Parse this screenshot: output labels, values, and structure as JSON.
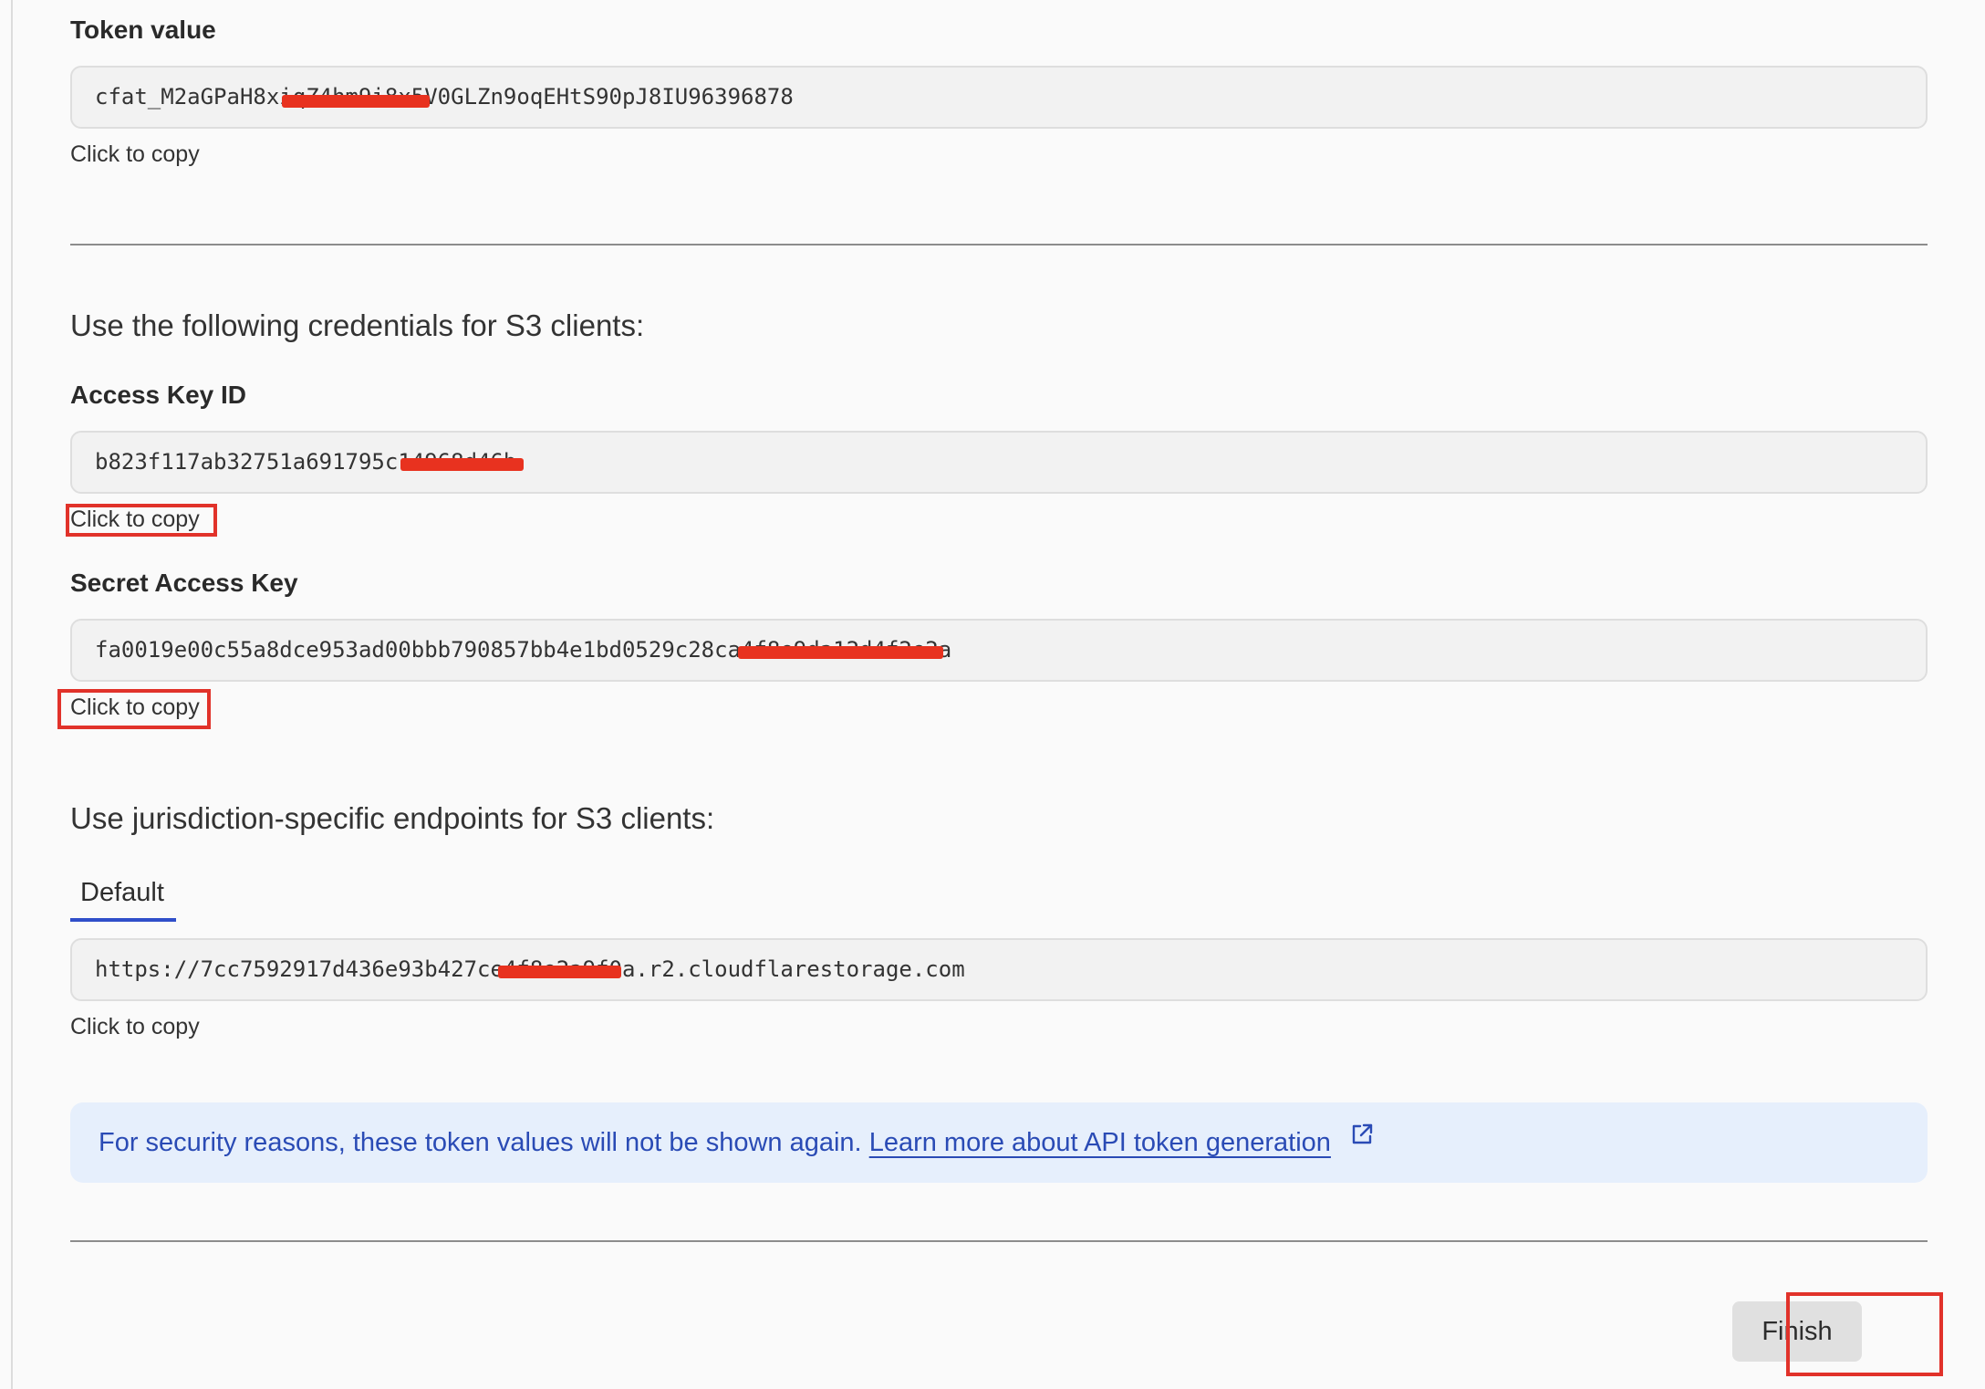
{
  "token": {
    "label": "Token value",
    "value": "cfat_M2aGPaH8xiqZ4hm9i8x5V0GLZn9oqEHtS90pJ8IU96396878",
    "copy_label": "Click to copy"
  },
  "s3": {
    "heading": "Use the following credentials for S3 clients:",
    "access_key": {
      "label": "Access Key ID",
      "value": "b823f117ab32751a691795c14968d46b",
      "copy_label": "Click to copy"
    },
    "secret_key": {
      "label": "Secret Access Key",
      "value": "fa0019e00c55a8dce953ad00bbb790857bb4e1bd0529c28ca4f8e9da12d4f2e2a",
      "copy_label": "Click to copy"
    }
  },
  "endpoints": {
    "heading": "Use jurisdiction-specific endpoints for S3 clients:",
    "tabs": [
      {
        "label": "Default",
        "active": true
      }
    ],
    "url": "https://7cc7592917d436e93b427ce4f8e2a9f0a.r2.cloudflarestorage.com",
    "copy_label": "Click to copy"
  },
  "notice": {
    "text": "For security reasons, these token values will not be shown again.",
    "link_label": "Learn more about API token generation",
    "icon": "external-link-icon"
  },
  "footer": {
    "finish_label": "Finish"
  },
  "colors": {
    "accent": "#2f4ec9",
    "annotation": "#e1322a",
    "redaction": "#e8321f",
    "notice_bg": "#e6effc",
    "notice_text": "#2a4bb5"
  }
}
